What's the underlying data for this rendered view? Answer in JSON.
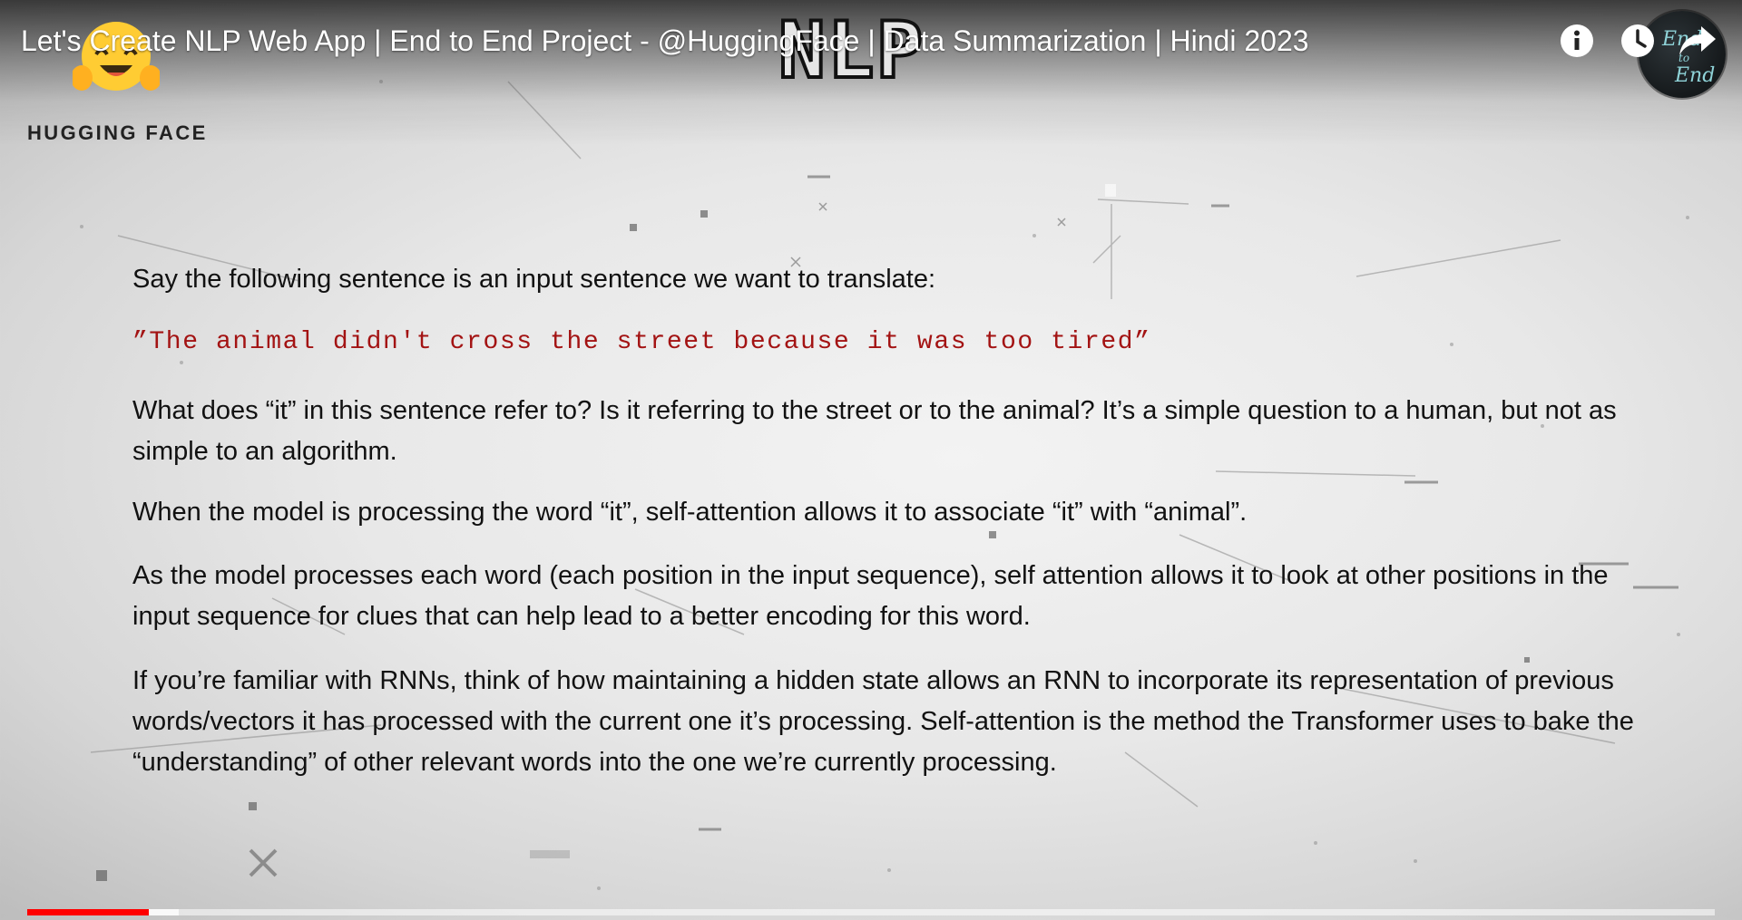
{
  "video": {
    "title": "Let's Create NLP Web App | End to End Project - @HuggingFace | Data Summarization | Hindi 2023",
    "progress_played_fraction": 0.072,
    "progress_buffered_fraction": 0.09
  },
  "slide": {
    "logo_text": "NLP",
    "brand_label": "HUGGING FACE",
    "intro": "Say the following sentence is an input sentence we want to translate:",
    "quote": "”The animal didn't cross the street because it was too tired”",
    "paragraphs": [
      "What does “it” in this sentence refer to? Is it referring to the street or to the animal? It’s a simple question to a human, but not as simple to an algorithm.",
      "When the model is processing the word “it”, self-attention allows it to associate “it” with “animal”.",
      "As the model processes each word (each position in the input sequence), self attention allows it to look at other positions in the input sequence for clues that can help lead to a better encoding for this word.",
      "If you’re familiar with RNNs, think of how maintaining a hidden state allows an RNN to incorporate its representation of previous words/vectors it has processed with the current one it’s processing. Self-attention is the method the Transformer uses to bake the “understanding” of other relevant words into the one we’re currently processing."
    ]
  },
  "controls": {
    "info_icon": "info-icon",
    "watch_later_icon": "clock-icon",
    "share_icon": "share-icon",
    "avatar_text_top": "End",
    "avatar_text_mid": "to",
    "avatar_text_bottom": "End"
  },
  "colors": {
    "quote_red": "#a31313",
    "progress_red": "#ff0000",
    "hf_yellow": "#ffcc33"
  }
}
